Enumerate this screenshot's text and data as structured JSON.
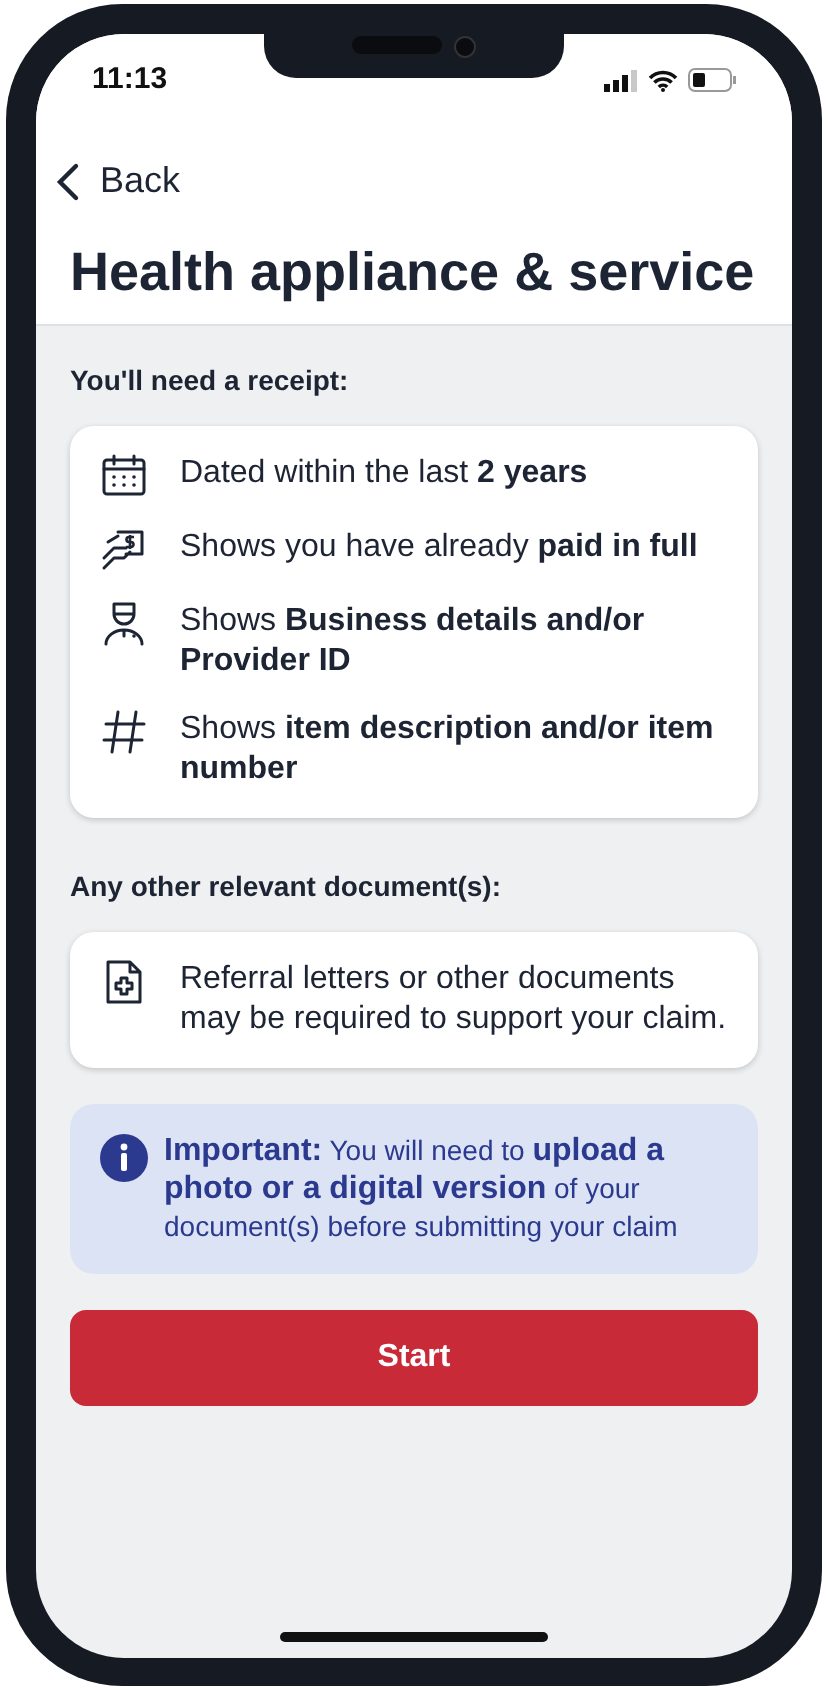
{
  "status_bar": {
    "time": "11:13"
  },
  "nav": {
    "back": "Back"
  },
  "title": "Health appliance & service",
  "receipt_section": {
    "heading": "You'll need a receipt:",
    "items": [
      {
        "kind": "calendar",
        "text": "Dated within the last **2 years**"
      },
      {
        "kind": "payment",
        "text": "Shows you have already **paid in full**"
      },
      {
        "kind": "provider",
        "text": "Shows **Business details and/or Provider ID**"
      },
      {
        "kind": "number",
        "text": "Shows **item description and/or item number**"
      }
    ]
  },
  "documents_section": {
    "heading": "Any other relevant document(s):",
    "items": [
      {
        "kind": "medical-document",
        "text": "Referral letters or other documents may be required to support your claim."
      }
    ]
  },
  "notice": {
    "text": "**Important:** You will need to **upload a photo or a digital version** of your document(s) before submitting your claim"
  },
  "start_button": "Start"
}
